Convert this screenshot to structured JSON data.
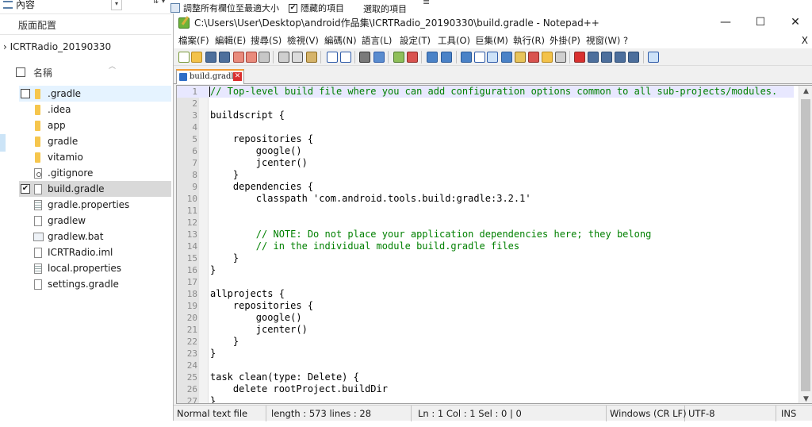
{
  "explorer": {
    "ribbon": {
      "view_label": "內容",
      "resize_columns_label": "調整所有欄位至最適大小",
      "hidden_items_checkbox": "✔",
      "hidden_items_label": "隱藏的項目",
      "selected_items_label": "選取的項目"
    },
    "group_label": "版面配置",
    "breadcrumb": "› ICRTRadio_20190330",
    "column_header": "名稱",
    "files": [
      {
        "name": ".gradle",
        "type": "folder",
        "checked": ""
      },
      {
        "name": ".idea",
        "type": "folder",
        "checked": ""
      },
      {
        "name": "app",
        "type": "folder",
        "checked": ""
      },
      {
        "name": "gradle",
        "type": "folder",
        "checked": ""
      },
      {
        "name": "vitamio",
        "type": "folder",
        "checked": ""
      },
      {
        "name": ".gitignore",
        "type": "gear",
        "checked": ""
      },
      {
        "name": "build.gradle",
        "type": "file",
        "checked": "✔"
      },
      {
        "name": "gradle.properties",
        "type": "lines",
        "checked": ""
      },
      {
        "name": "gradlew",
        "type": "file",
        "checked": ""
      },
      {
        "name": "gradlew.bat",
        "type": "bat",
        "checked": ""
      },
      {
        "name": "ICRTRadio.iml",
        "type": "file",
        "checked": ""
      },
      {
        "name": "local.properties",
        "type": "lines",
        "checked": ""
      },
      {
        "name": "settings.gradle",
        "type": "file",
        "checked": ""
      }
    ]
  },
  "npp": {
    "title": "C:\\Users\\User\\Desktop\\android作品集\\ICRTRadio_20190330\\build.gradle - Notepad++",
    "window_buttons": {
      "minimize": "—",
      "maximize": "☐",
      "close": "✕"
    },
    "menu": [
      "檔案(F)",
      "編輯(E)",
      "搜尋(S)",
      "檢視(V)",
      "編碼(N)",
      "語言(L)",
      "設定(T)",
      "工具(O)",
      "巨集(M)",
      "執行(R)",
      "外掛(P)",
      "視窗(W)",
      "?"
    ],
    "menu_close": "X",
    "tab_label": "build.gradle",
    "tab_close": "✕",
    "code_lines": [
      "// Top-level build file where you can add configuration options common to all sub-projects/modules.",
      "",
      "buildscript {",
      "",
      "    repositories {",
      "        google()",
      "        jcenter()",
      "    }",
      "    dependencies {",
      "        classpath 'com.android.tools.build:gradle:3.2.1'",
      "",
      "",
      "        // NOTE: Do not place your application dependencies here; they belong",
      "        // in the individual module build.gradle files",
      "    }",
      "}",
      "",
      "allprojects {",
      "    repositories {",
      "        google()",
      "        jcenter()",
      "    }",
      "}",
      "",
      "task clean(type: Delete) {",
      "    delete rootProject.buildDir",
      "}"
    ],
    "status": {
      "lang": "Normal text file",
      "length": "length : 573    lines : 28",
      "position": "Ln : 1    Col : 1    Sel : 0 | 0",
      "eol": "Windows (CR LF)",
      "encoding": "UTF-8",
      "mode": "INS"
    }
  }
}
